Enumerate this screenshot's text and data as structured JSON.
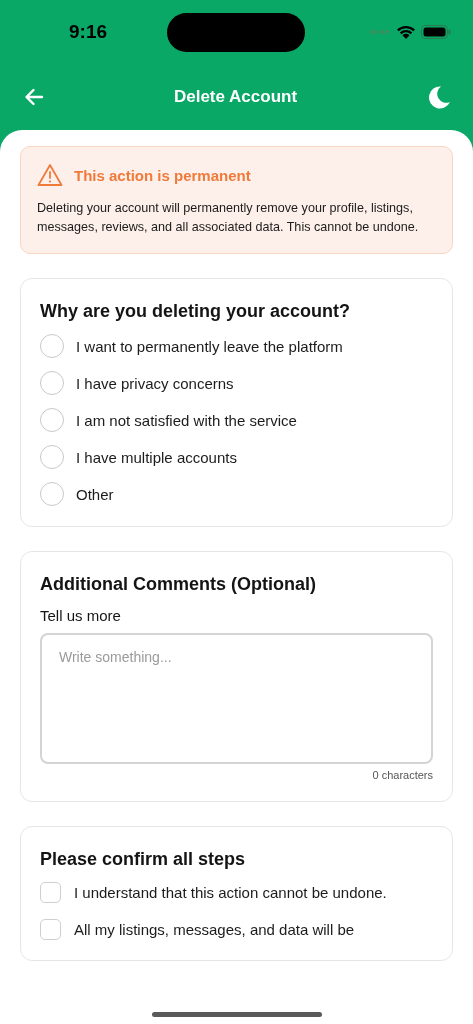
{
  "status_bar": {
    "time": "9:16"
  },
  "header": {
    "title": "Delete Account"
  },
  "warning": {
    "title": "This action is permanent",
    "body": "Deleting your account will permanently remove your profile, listings, messages, reviews, and all associated data. This cannot be undone."
  },
  "reasons": {
    "title": "Why are you deleting your account?",
    "options": [
      {
        "label": "I want to permanently leave the platform",
        "selected": false
      },
      {
        "label": "I have privacy concerns",
        "selected": false
      },
      {
        "label": "I am not satisfied with the service",
        "selected": false
      },
      {
        "label": "I have multiple accounts",
        "selected": false
      },
      {
        "label": "Other",
        "selected": false
      }
    ]
  },
  "comments": {
    "title": "Additional Comments (Optional)",
    "label": "Tell us more",
    "placeholder": "Write something...",
    "counter": "0 characters"
  },
  "confirm": {
    "title": "Please confirm all steps",
    "steps": [
      {
        "label": "I understand that this action cannot be undone.",
        "checked": false
      },
      {
        "label": "All my listings, messages, and data will be",
        "checked": false
      }
    ]
  }
}
